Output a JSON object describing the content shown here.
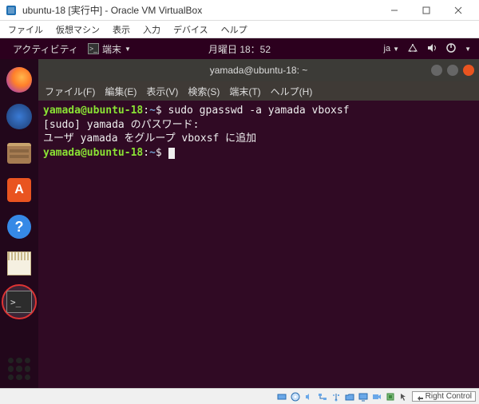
{
  "vbox": {
    "title": "ubuntu-18 [実行中] - Oracle VM VirtualBox",
    "menu": [
      "ファイル",
      "仮想マシン",
      "表示",
      "入力",
      "デバイス",
      "ヘルプ"
    ],
    "host_key": "Right Control"
  },
  "ubuntu": {
    "activities": "アクティビティ",
    "app_name": "端末",
    "clock": "月曜日 18：52",
    "lang": "ja"
  },
  "terminal": {
    "title": "yamada@ubuntu-18: ~",
    "menu": [
      "ファイル(F)",
      "編集(E)",
      "表示(V)",
      "検索(S)",
      "端末(T)",
      "ヘルプ(H)"
    ],
    "prompt_user": "yamada@ubuntu-18",
    "prompt_path": "~",
    "lines": [
      {
        "type": "prompt",
        "cmd": "sudo gpasswd -a yamada vboxsf"
      },
      {
        "type": "output",
        "text": "[sudo] yamada のパスワード:"
      },
      {
        "type": "output",
        "text": "ユーザ yamada をグループ vboxsf に追加"
      },
      {
        "type": "prompt",
        "cmd": "",
        "cursor": true
      }
    ]
  },
  "dock": {
    "items": [
      {
        "name": "firefox"
      },
      {
        "name": "thunderbird"
      },
      {
        "name": "files"
      },
      {
        "name": "software"
      },
      {
        "name": "help"
      },
      {
        "name": "text-editor"
      },
      {
        "name": "terminal",
        "selected": true,
        "circled": true
      }
    ]
  }
}
